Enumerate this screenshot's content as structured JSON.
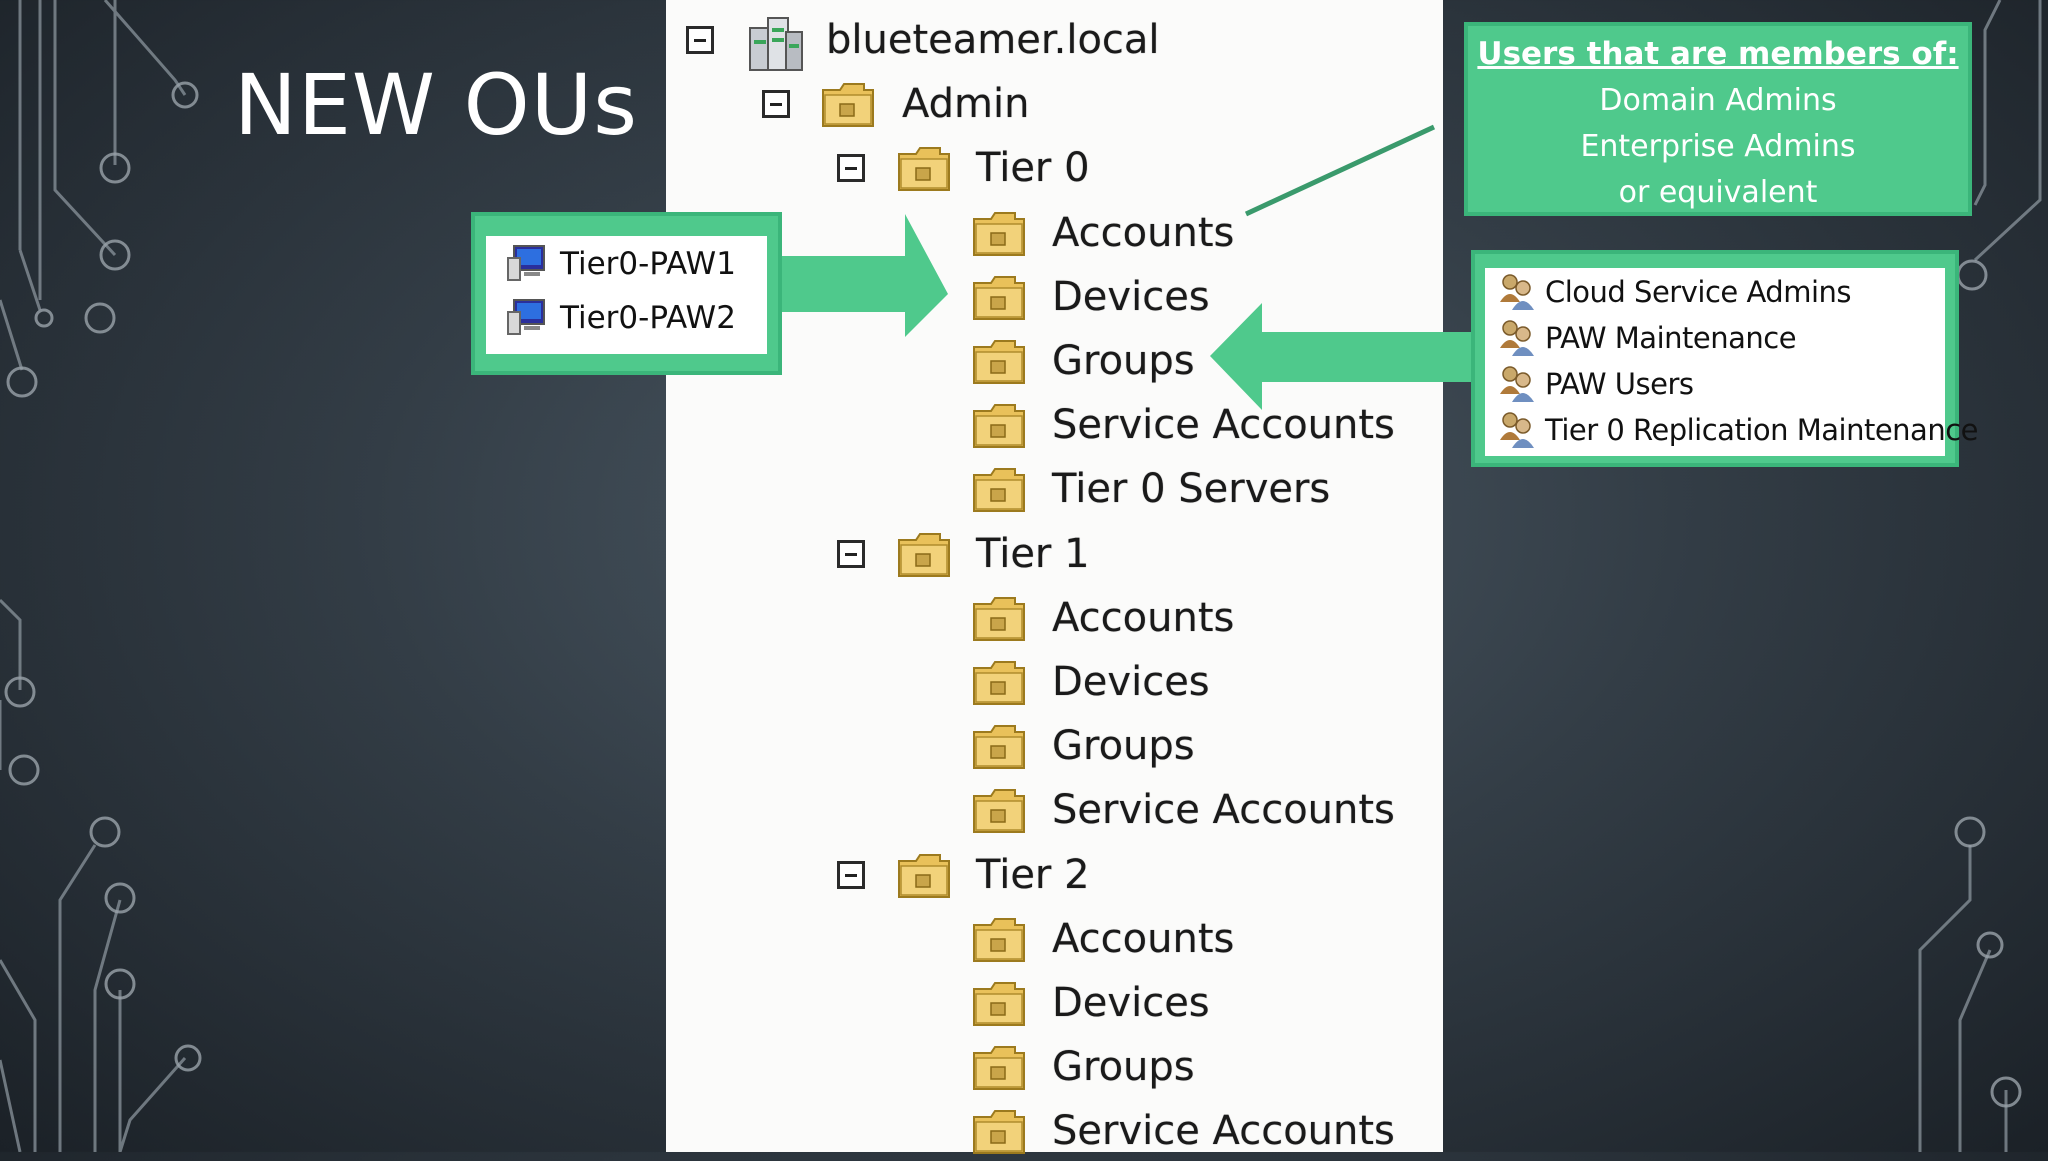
{
  "slide": {
    "title": "NEW OUs"
  },
  "tree": {
    "root": {
      "label": "blueteamer.local",
      "icon": "domain-icon"
    },
    "admin": {
      "label": "Admin",
      "icon": "ou-folder-icon"
    },
    "tiers": [
      {
        "label": "Tier 0",
        "children": [
          "Accounts",
          "Devices",
          "Groups",
          "Service Accounts",
          "Tier 0 Servers"
        ]
      },
      {
        "label": "Tier 1",
        "children": [
          "Accounts",
          "Devices",
          "Groups",
          "Service Accounts"
        ]
      },
      {
        "label": "Tier 2",
        "children": [
          "Accounts",
          "Devices",
          "Groups",
          "Service Accounts"
        ]
      }
    ]
  },
  "paw_callout": {
    "items": [
      {
        "label": "Tier0-PAW1",
        "icon": "computer-icon"
      },
      {
        "label": "Tier0-PAW2",
        "icon": "computer-icon"
      }
    ]
  },
  "members_callout": {
    "heading": "Users that are members of:",
    "lines": [
      "Domain Admins",
      "Enterprise Admins",
      "or equivalent"
    ]
  },
  "groups_callout": {
    "items": [
      {
        "label": "Cloud Service Admins",
        "icon": "group-icon"
      },
      {
        "label": "PAW Maintenance",
        "icon": "group-icon"
      },
      {
        "label": "PAW Users",
        "icon": "group-icon"
      },
      {
        "label": "Tier 0 Replication Maintenance",
        "icon": "group-icon"
      }
    ]
  },
  "colors": {
    "accent": "#4fc98c",
    "accent_border": "#3bb57a",
    "background": "#333d46",
    "panel": "#fbfbfa"
  }
}
